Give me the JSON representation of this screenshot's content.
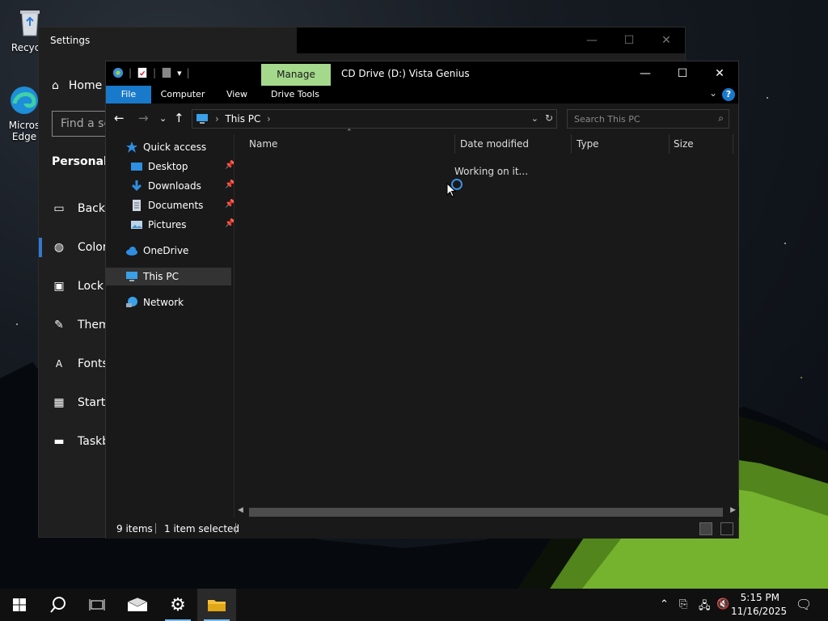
{
  "desktop": {
    "icons": [
      {
        "label": "Recycle",
        "icon": "recycle-bin-icon"
      },
      {
        "label": "Micros Edge",
        "label_line1": "Micros",
        "label_line2": "Edge",
        "icon": "edge-icon"
      }
    ]
  },
  "settings": {
    "title": "Settings",
    "home": "Home",
    "search_placeholder": "Find a se",
    "heading": "Personaliz",
    "nav": [
      {
        "label": "Backg",
        "icon": "picture-icon"
      },
      {
        "label": "Color",
        "icon": "palette-icon"
      },
      {
        "label": "Lock s",
        "icon": "lock-screen-icon"
      },
      {
        "label": "Them",
        "icon": "brush-icon"
      },
      {
        "label": "Fonts",
        "icon": "font-icon"
      },
      {
        "label": "Start",
        "icon": "start-grid-icon"
      },
      {
        "label": "Taskb",
        "icon": "taskbar-icon"
      }
    ]
  },
  "explorer": {
    "manage_tab": "Manage",
    "window_title": "CD Drive (D:) Vista Genius",
    "ribbon_tabs": [
      "File",
      "Computer",
      "View",
      "Drive Tools"
    ],
    "address": {
      "crumb": "This PC",
      "sep": "›"
    },
    "search_placeholder": "Search This PC",
    "nav": {
      "quick_access": "Quick access",
      "desktop": "Desktop",
      "downloads": "Downloads",
      "documents": "Documents",
      "pictures": "Pictures",
      "onedrive": "OneDrive",
      "this_pc": "This PC",
      "network": "Network"
    },
    "columns": [
      "Name",
      "Date modified",
      "Type",
      "Size"
    ],
    "working_text": "Working on it...",
    "status": {
      "items": "9 items",
      "selected": "1 item selected"
    }
  },
  "taskbar": {
    "time": "5:15 PM",
    "date": "11/16/2025"
  },
  "colors": {
    "accent": "#1979ca",
    "manage_tab": "#a4d98c",
    "window_bg": "#191919"
  }
}
